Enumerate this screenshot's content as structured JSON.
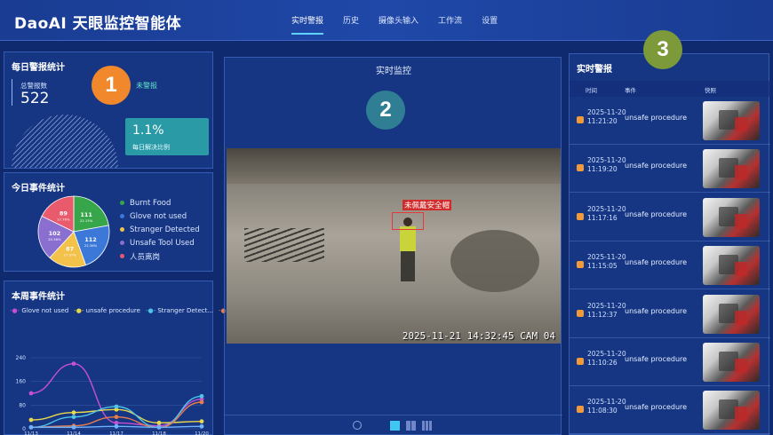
{
  "app": {
    "title": "DaoAI 天眼监控智能体"
  },
  "nav": {
    "items": [
      "实时警报",
      "历史",
      "摄像头输入",
      "工作流",
      "设置"
    ]
  },
  "badges": [
    "1",
    "2",
    "3"
  ],
  "daily_stats": {
    "title": "每日警报统计",
    "total_label": "总警报数",
    "total_value": "522",
    "legend_label": "未警报",
    "rate_value": "1.1%",
    "rate_label": "每日解决比例"
  },
  "today_events": {
    "title": "今日事件统计",
    "pie": [
      {
        "label": "Burnt Food",
        "count": "111",
        "pct": "22.15%",
        "color": "#37a64b"
      },
      {
        "label": "Glove not used",
        "count": "112",
        "pct": "22.36%",
        "color": "#3b78d8"
      },
      {
        "label": "Stranger Detected",
        "count": "87",
        "pct": "17.37%",
        "color": "#f3c24b"
      },
      {
        "label": "Unsafe Tool Used",
        "count": "102",
        "pct": "20.36%",
        "color": "#8a6fd0"
      },
      {
        "label": "人员离岗",
        "count": "89",
        "pct": "17.76%",
        "color": "#e85a6c"
      }
    ]
  },
  "weekly_events": {
    "title": "本周事件统计",
    "legend": [
      {
        "label": "Glove not used",
        "color": "#c74fd4"
      },
      {
        "label": "unsafe procedure",
        "color": "#e8d84a"
      },
      {
        "label": "Stranger Detect...",
        "color": "#4fc3e8"
      },
      {
        "label": "人员离岗",
        "color": "#e87c4a"
      },
      {
        "label": "Burnt Food",
        "color": "#6fb3ff"
      }
    ]
  },
  "chart_data": {
    "type": "line",
    "x": [
      "11/13",
      "11/14",
      "11/17",
      "11/18",
      "11/20"
    ],
    "ylim": [
      0,
      300
    ],
    "yticks": [
      0,
      80,
      160,
      240
    ],
    "series": [
      {
        "name": "Glove not used",
        "values": [
          120,
          220,
          20,
          10,
          100
        ]
      },
      {
        "name": "unsafe procedure",
        "values": [
          30,
          55,
          65,
          20,
          25
        ]
      },
      {
        "name": "Stranger Detect...",
        "values": [
          5,
          40,
          75,
          5,
          110
        ]
      },
      {
        "name": "人员离岗",
        "values": [
          5,
          10,
          40,
          5,
          90
        ]
      },
      {
        "name": "Burnt Food",
        "values": [
          5,
          5,
          8,
          5,
          8
        ]
      }
    ]
  },
  "monitor": {
    "title": "实时监控",
    "detection_label": "未佩戴安全帽",
    "timestamp": "2025-11-21 14:32:45 CAM 04"
  },
  "alerts": {
    "title": "实时警报",
    "col_time": "时间",
    "col_event": "事件",
    "col_snapshot": "快照",
    "rows": [
      {
        "date": "2025-11-20",
        "time": "11:21:20",
        "event": "unsafe procedure"
      },
      {
        "date": "2025-11-20",
        "time": "11:19:20",
        "event": "unsafe procedure"
      },
      {
        "date": "2025-11-20",
        "time": "11:17:16",
        "event": "unsafe procedure"
      },
      {
        "date": "2025-11-20",
        "time": "11:15:05",
        "event": "unsafe procedure"
      },
      {
        "date": "2025-11-20",
        "time": "11:12:37",
        "event": "unsafe procedure"
      },
      {
        "date": "2025-11-20",
        "time": "11:10:26",
        "event": "unsafe procedure"
      },
      {
        "date": "2025-11-20",
        "time": "11:08:30",
        "event": "unsafe procedure"
      }
    ]
  },
  "icons": {
    "settings": "settings-icon",
    "layout_single": "layout-single-icon",
    "layout_quad": "layout-quad-icon",
    "layout_nine": "layout-nine-icon"
  }
}
